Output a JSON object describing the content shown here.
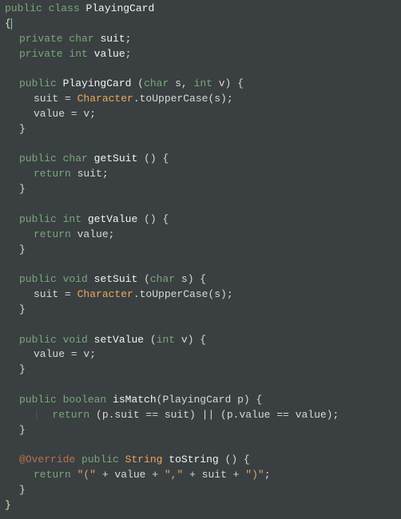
{
  "code": {
    "l1": {
      "kw1": "public",
      "kw2": "class",
      "name": "PlayingCard"
    },
    "l2": {
      "brace": "{"
    },
    "l3": {
      "kw1": "private",
      "kw2": "char",
      "name": "suit",
      "semi": ";"
    },
    "l4": {
      "kw1": "private",
      "kw2": "int",
      "name": "value",
      "semi": ";"
    },
    "l6": {
      "kw1": "public",
      "name": "PlayingCard",
      "params": "(",
      "kw2": "char",
      "p1": " s, ",
      "kw3": "int",
      "p2": " v) {"
    },
    "l7": {
      "lhs": "suit = ",
      "cls": "Character",
      "call": ".toUpperCase(s);"
    },
    "l8": {
      "txt": "value = v;"
    },
    "l9": {
      "brace": "}"
    },
    "l11": {
      "kw1": "public",
      "kw2": "char",
      "name": "getSuit",
      "rest": " () {"
    },
    "l12": {
      "kw1": "return",
      "rest": " suit;"
    },
    "l13": {
      "brace": "}"
    },
    "l15": {
      "kw1": "public",
      "kw2": "int",
      "name": "getValue",
      "rest": " () {"
    },
    "l16": {
      "kw1": "return",
      "rest": " value;"
    },
    "l17": {
      "brace": "}"
    },
    "l19": {
      "kw1": "public",
      "kw2": "void",
      "name": "setSuit",
      "rest": " (",
      "kw3": "char",
      "rest2": " s) {"
    },
    "l20": {
      "lhs": "suit = ",
      "cls": "Character",
      "call": ".toUpperCase(s);"
    },
    "l21": {
      "brace": "}"
    },
    "l23": {
      "kw1": "public",
      "kw2": "void",
      "name": "setValue",
      "rest": " (",
      "kw3": "int",
      "rest2": " v) {"
    },
    "l24": {
      "txt": "value = v;"
    },
    "l25": {
      "brace": "}"
    },
    "l27": {
      "kw1": "public",
      "kw2": "boolean",
      "name": "isMatch",
      "rest": "(PlayingCard p) {"
    },
    "l28": {
      "guide": "|  ",
      "kw1": "return",
      "rest": " (p.suit == suit) || (p.value == value);"
    },
    "l29": {
      "brace": "}"
    },
    "l31": {
      "at": "@",
      "ov": "Override",
      "sp": " ",
      "kw1": "public",
      "sp2": " ",
      "cls": "String",
      "sp3": " ",
      "name": "toString",
      "rest": " () {"
    },
    "l32": {
      "kw1": "return",
      "sp": " ",
      "lit1": "\"(\"",
      "p1": " + value + ",
      "lit2": "\",\"",
      "p2": " + suit + ",
      "lit3": "\")\"",
      "semi": ";"
    },
    "l33": {
      "brace": "}"
    },
    "l34": {
      "brace": "}"
    }
  }
}
